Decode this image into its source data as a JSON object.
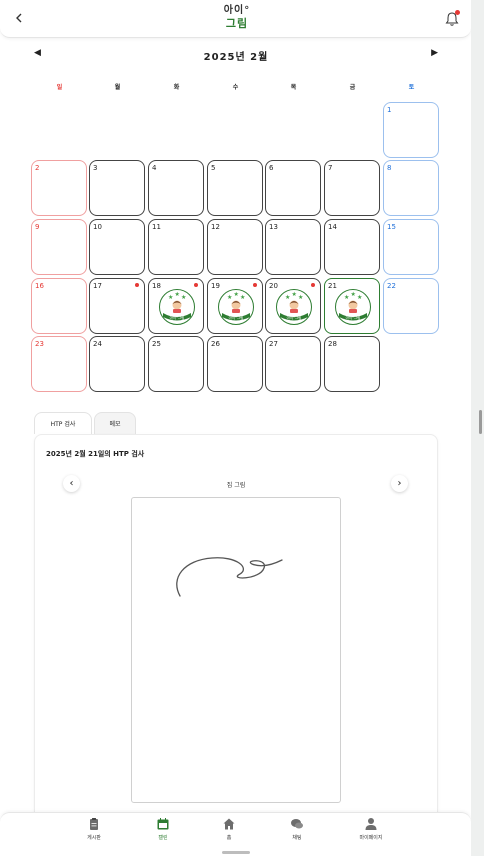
{
  "header": {
    "back_icon": "chevron-left-icon",
    "logo_line1": "아이°",
    "logo_line2": "그림",
    "bell_icon": "bell-icon"
  },
  "calendar": {
    "title": "2025년   2월",
    "prev_icon": "triangle-left-icon",
    "next_icon": "triangle-right-icon",
    "weekdays": [
      "일",
      "월",
      "화",
      "수",
      "목",
      "금",
      "토"
    ],
    "weeks": [
      [
        "",
        "",
        "",
        "",
        "",
        "",
        "1"
      ],
      [
        "2",
        "3",
        "4",
        "5",
        "6",
        "7",
        "8"
      ],
      [
        "9",
        "10",
        "11",
        "12",
        "13",
        "14",
        "15"
      ],
      [
        "16",
        "17",
        "18",
        "19",
        "20",
        "21",
        "22"
      ],
      [
        "23",
        "24",
        "25",
        "26",
        "27",
        "28",
        ""
      ]
    ],
    "stamp_text": "아이°그림",
    "sunday_color": "#e53935",
    "saturday_color": "#1e6fd9",
    "accent_color": "#2e7d32"
  },
  "tabs": [
    {
      "label": "HTP 검사"
    },
    {
      "label": "메모"
    }
  ],
  "panel": {
    "title": "2025년 2월 21일의 HTP 검사",
    "drawing_label": "집 그림",
    "prev_icon": "chevron-left-icon",
    "next_icon": "chevron-right-icon"
  },
  "bottom_nav": [
    {
      "label": "게시판",
      "icon": "clipboard-icon"
    },
    {
      "label": "캘린",
      "icon": "calendar-icon"
    },
    {
      "label": "홈",
      "icon": "home-icon"
    },
    {
      "label": "채팅",
      "icon": "chat-bubbles-icon"
    },
    {
      "label": "마이페이지",
      "icon": "person-icon"
    }
  ]
}
